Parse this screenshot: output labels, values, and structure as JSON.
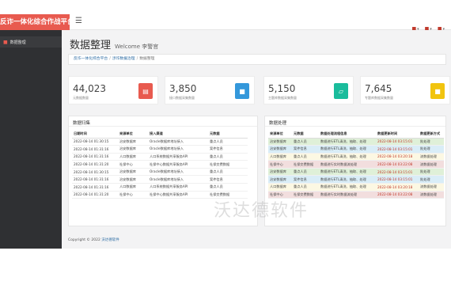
{
  "app": {
    "brand": "反诈一体化综合作战平台"
  },
  "topbar": {
    "icons": [
      "flag-icon",
      "mail-icon",
      "user-icon"
    ]
  },
  "sidebar": {
    "items": [
      {
        "label": "数据整理",
        "active": true
      }
    ]
  },
  "page": {
    "title": "数据整理",
    "welcome": "Welcome 李警官"
  },
  "breadcrumb": {
    "items": [
      "反诈一体化综合平台",
      "涉诈数据治理"
    ],
    "current": "数据整理"
  },
  "stats": [
    {
      "value": "44,023",
      "caption": "元数据数量",
      "color": "#e85a4f",
      "icon": "chart-icon"
    },
    {
      "value": "3,850",
      "caption": "接口数据采集数量",
      "color": "#3498db",
      "icon": "folder-icon"
    },
    {
      "value": "5,150",
      "caption": "主题库数据采集数量",
      "color": "#1abc9c",
      "icon": "folder-open-icon"
    },
    {
      "value": "7,645",
      "caption": "专题库数据采集数量",
      "color": "#f1c40f",
      "icon": "folder-icon"
    }
  ],
  "left_panel": {
    "title": "数据归集",
    "headers": [
      "日期时间",
      "来源单位",
      "接入渠道",
      "元数据"
    ],
    "rows": [
      [
        "2022-08-14 01:30:15",
        "治安数据库",
        "Oracle数据库地址接入",
        "重点人员"
      ],
      [
        "2022-08-14 01:31:16",
        "治安数据库",
        "Oracle数据库地址接入",
        "案件信息"
      ],
      [
        "2022-08-14 01:31:16",
        "人口数据库",
        "人口系统数据共享服务API",
        "重点人员"
      ],
      [
        "2022-08-14 01:31:20",
        "社保中心",
        "社保中心数据共享服务API",
        "社保交费数据"
      ],
      [
        "2022-08-14 01:30:15",
        "治安数据库",
        "Oracle数据库地址接入",
        "重点人员"
      ],
      [
        "2022-08-14 01:31:16",
        "治安数据库",
        "Oracle数据库地址接入",
        "案件信息"
      ],
      [
        "2022-08-14 01:31:16",
        "人口数据库",
        "人口系统数据共享服务API",
        "重点人员"
      ],
      [
        "2022-08-14 01:31:20",
        "社保中心",
        "社保中心数据共享服务API",
        "社保交费数据"
      ]
    ]
  },
  "right_panel": {
    "title": "数据处理",
    "headers": [
      "来源单位",
      "元数据",
      "数据处理流程信息",
      "数据更新时间",
      "数据更新方式"
    ],
    "rows": [
      {
        "cells": [
          "治安数据库",
          "重点人员",
          "数据进行ETL清洗、抽取、处理",
          "2022-08-14 03:15:01",
          "批处理"
        ],
        "color": "#dff0d8"
      },
      {
        "cells": [
          "治安数据库",
          "案件信息",
          "数据进行ETL清洗、抽取、处理",
          "2022-08-14 03:15:01",
          "批处理"
        ],
        "color": "#d9edf7"
      },
      {
        "cells": [
          "人口数据库",
          "重点人员",
          "数据进行ETL清洗、抽取、处理",
          "2022-08-14 03:20:18",
          "流数据处理"
        ],
        "color": "#fcf8e3"
      },
      {
        "cells": [
          "社保中心",
          "社保交费数据",
          "数据进行实时数据流处理",
          "2022-08-14 03:22:08",
          "流数据处理"
        ],
        "color": "#f2dede"
      },
      {
        "cells": [
          "治安数据库",
          "重点人员",
          "数据进行ETL清洗、抽取、处理",
          "2022-08-14 03:15:01",
          "批处理"
        ],
        "color": "#dff0d8"
      },
      {
        "cells": [
          "治安数据库",
          "案件信息",
          "数据进行ETL清洗、抽取、处理",
          "2022-08-14 03:15:01",
          "批处理"
        ],
        "color": "#d9edf7"
      },
      {
        "cells": [
          "人口数据库",
          "重点人员",
          "数据进行ETL清洗、抽取、处理",
          "2022-08-14 03:20:18",
          "流数据处理"
        ],
        "color": "#fcf8e3"
      },
      {
        "cells": [
          "社保中心",
          "社保交费数据",
          "数据进行实时数据流处理",
          "2022-08-14 03:22:08",
          "流数据处理"
        ],
        "color": "#f2dede"
      }
    ]
  },
  "footer": {
    "text": "Copyright © 2022",
    "link": "沃达德软件"
  },
  "watermark": "沃达德软件"
}
